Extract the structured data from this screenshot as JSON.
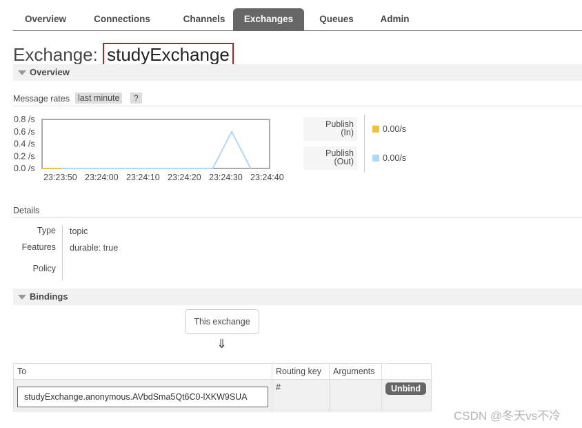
{
  "tabs": [
    {
      "label": "Overview",
      "active": false
    },
    {
      "label": "Connections",
      "active": false
    },
    {
      "label": "Channels",
      "active": false
    },
    {
      "label": "Exchanges",
      "active": true
    },
    {
      "label": "Queues",
      "active": false
    },
    {
      "label": "Admin",
      "active": false
    }
  ],
  "title": {
    "prefix": "Exchange:",
    "name": "studyExchange"
  },
  "overview": {
    "section_label": "Overview",
    "rates_label": "Message rates",
    "range_label": "last minute",
    "help_label": "?"
  },
  "chart_data": {
    "type": "line",
    "x": [
      "23:23:50",
      "23:24:00",
      "23:24:10",
      "23:24:20",
      "23:24:30",
      "23:24:40"
    ],
    "y_ticks": [
      "0.8 /s",
      "0.6 /s",
      "0.4 /s",
      "0.2 /s",
      "0.0 /s"
    ],
    "ylim": [
      0,
      0.8
    ],
    "series": [
      {
        "name": "Publish (In)",
        "color": "#edc240",
        "points": [
          [
            0,
            0
          ],
          [
            5,
            0
          ]
        ]
      },
      {
        "name": "Publish (Out)",
        "color": "#afd8f8",
        "points": [
          [
            0,
            0
          ],
          [
            45,
            0
          ],
          [
            50,
            0.6
          ],
          [
            55,
            0
          ]
        ]
      }
    ]
  },
  "legend": [
    {
      "line1": "Publish",
      "line2": "(In)",
      "value": "0.00/s",
      "color": "#edc240"
    },
    {
      "line1": "Publish",
      "line2": "(Out)",
      "value": "0.00/s",
      "color": "#afd8f8"
    }
  ],
  "details": {
    "heading": "Details",
    "type_label": "Type",
    "type_value": "topic",
    "features_label": "Features",
    "durable_key": "durable:",
    "durable_value": "true",
    "policy_label": "Policy"
  },
  "bindings": {
    "section_label": "Bindings",
    "this_exchange": "This exchange",
    "arrow": "⇓",
    "headers": {
      "to": "To",
      "routing_key": "Routing key",
      "arguments": "Arguments"
    },
    "rows": [
      {
        "to": "studyExchange.anonymous.AVbdSma5Qt6C0-lXKW9SUA",
        "routing_key": "#",
        "arguments": "",
        "action": "Unbind"
      }
    ]
  },
  "watermark": "CSDN @冬天vs不冷"
}
